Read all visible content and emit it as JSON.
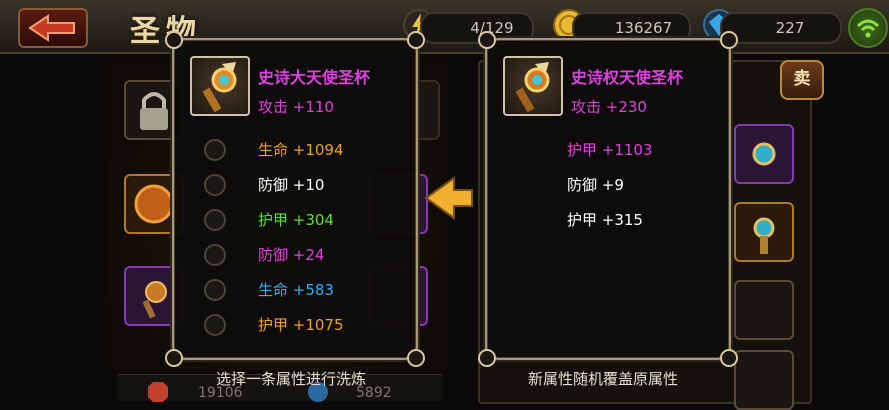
{
  "header": {
    "title": "圣物",
    "resources": [
      {
        "name": "stamina",
        "value": "4/129",
        "icon": "lightning-icon"
      },
      {
        "name": "gold",
        "value": "136267",
        "icon": "gold-coin-icon"
      },
      {
        "name": "diamond",
        "value": "227",
        "icon": "blue-gem-icon"
      }
    ]
  },
  "board": {
    "sell_label": "卖",
    "bottom_values": [
      "19106",
      "5892"
    ]
  },
  "current_item": {
    "name": "史诗大天使圣杯",
    "attack": "攻击 +110",
    "stats": [
      {
        "label": "生命 +1094",
        "color": "#f0a020"
      },
      {
        "label": "防御 +10",
        "color": "#ffffff"
      },
      {
        "label": "护甲 +304",
        "color": "#5be02a"
      },
      {
        "label": "防御 +24",
        "color": "#e040e0"
      },
      {
        "label": "生命 +583",
        "color": "#30b0f0"
      },
      {
        "label": "护甲 +1075",
        "color": "#f0a020"
      }
    ],
    "caption": "选择一条属性进行洗炼"
  },
  "new_item": {
    "name": "史诗权天使圣杯",
    "attack": "攻击 +230",
    "stats": [
      {
        "label": "护甲 +1103",
        "color": "#e040e0"
      },
      {
        "label": "防御 +9",
        "color": "#ffffff"
      },
      {
        "label": "护甲 +315",
        "color": "#ffffff"
      }
    ],
    "caption": "新属性随机覆盖原属性"
  },
  "colors": {
    "epic_purple": "#e040e0",
    "panel_border": "#a8987a",
    "arrow": "#f0b030"
  }
}
